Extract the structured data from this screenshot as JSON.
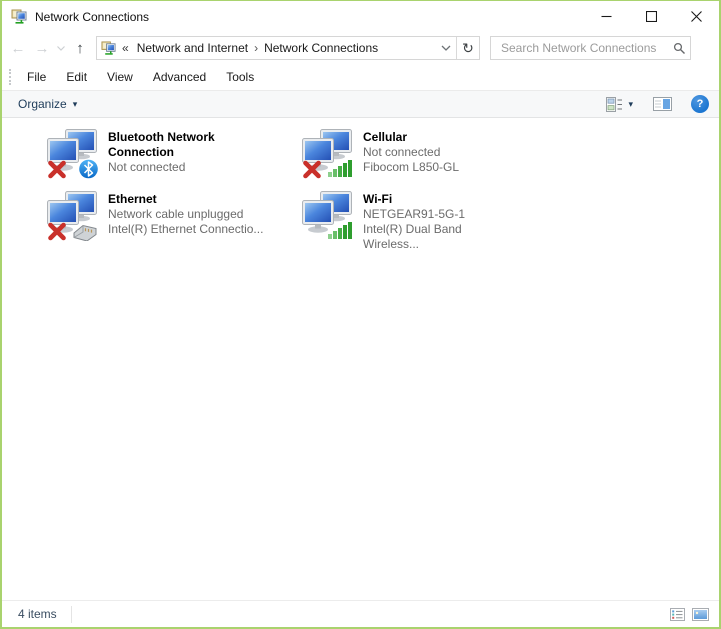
{
  "window": {
    "title": "Network Connections"
  },
  "icons": {
    "back": "←",
    "forward": "→",
    "up": "↑",
    "refresh": "↻",
    "dropdown_arrow": "▾",
    "breadcrumb_overflow": "«",
    "breadcrumb_separator": "›",
    "help": "?"
  },
  "navigation": {
    "breadcrumb": [
      "Network and Internet",
      "Network Connections"
    ],
    "search_placeholder": "Search Network Connections"
  },
  "menu": {
    "items": [
      "File",
      "Edit",
      "View",
      "Advanced",
      "Tools"
    ]
  },
  "toolbar": {
    "organize": "Organize"
  },
  "connections": [
    {
      "name": "Bluetooth Network Connection",
      "line2": "Not connected"
    },
    {
      "name": "Cellular",
      "line2": "Not connected",
      "line3": "Fibocom L850-GL"
    },
    {
      "name": "Ethernet",
      "line2": "Network cable unplugged",
      "line3": "Intel(R) Ethernet Connectio..."
    },
    {
      "name": "Wi-Fi",
      "line2": "NETGEAR91-5G-1",
      "line3": "Intel(R) Dual Band Wireless..."
    }
  ],
  "statusbar": {
    "count": "4 items"
  },
  "colors": {
    "window_border": "#a9d36e",
    "organize_text": "#1e3c5a",
    "help_blue": "#1c76d1",
    "disconnected_red": "#c9302a",
    "signal_green": "#2f9e2f",
    "screen_blue": "#2c62c8"
  }
}
